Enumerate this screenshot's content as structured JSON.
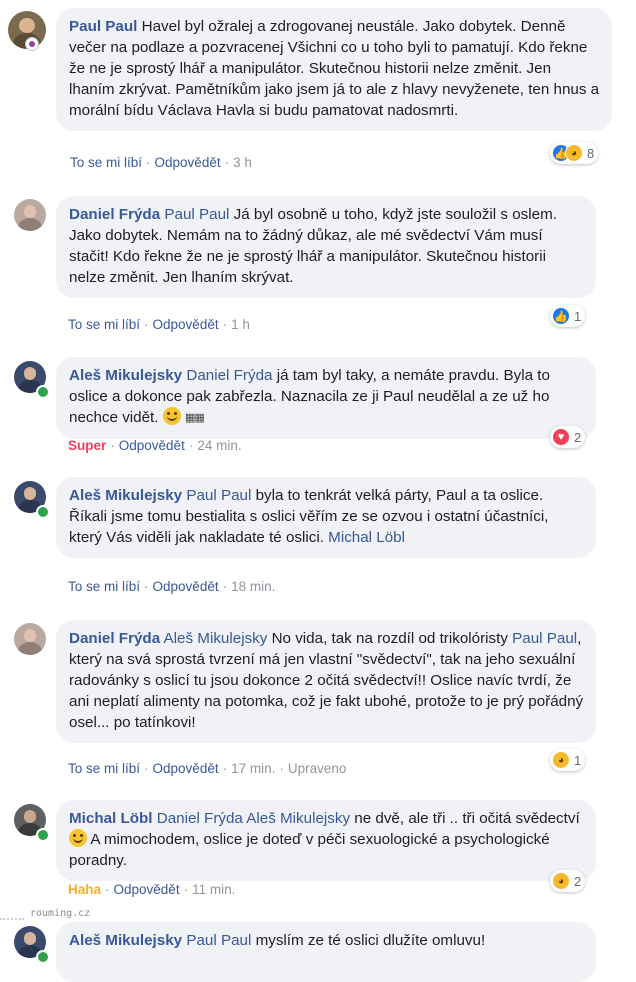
{
  "colors": {
    "link": "#385898",
    "bubble": "#f0f2f5",
    "meta": "#90949c",
    "super": "#f33e58",
    "haha": "#f7b125",
    "online": "#31a24c"
  },
  "comments": [
    {
      "author": "Paul Paul",
      "mentions": "",
      "text": "Havel byl ožralej a zdrogovanej neustále. Jako dobytek. Denně večer na podlaze a pozvracenej Všichni co u toho byli to pamatují. Kdo řekne že ne je sprostý lhář a manipulátor. Skutečnou historii nelze změnit. Jen lhaním zkrývat. Pamětníkům jako jsem já to ale z hlavy nevyženete, ten hnus a morální bídu Václava Havla si budu pamatovat nadosmrti.",
      "like": "To se mi líbí",
      "reply": "Odpovědět",
      "time": "3 h",
      "reaction_icons": [
        "like-icon",
        "haha-icon"
      ],
      "reaction_count": "8"
    },
    {
      "author": "Daniel Frýda",
      "mentions": "Paul Paul",
      "text": " Já byl osobně u toho, když jste souložil s oslem. Jako dobytek. Nemám na to žádný důkaz, ale mé svědectví Vám musí stačit! Kdo řekne že ne je sprostý lhář a manipulátor. Skutečnou historii nelze změnit. Jen lhaním skrývat.",
      "like": "To se mi líbí",
      "reply": "Odpovědět",
      "time": "1 h",
      "reaction_icons": [
        "like-icon"
      ],
      "reaction_count": "1"
    },
    {
      "author": "Aleš Mikulejsky",
      "mentions": "Daniel Frýda",
      "text": " já tam byl taky, a nemáte pravdu. Byla to oslice a dokonce pak zabřezla. Naznacila ze ji Paul neudělal a ze už ho nechce vidět.",
      "emoji": [
        "smirk-emoji-icon",
        "small-flag-icon"
      ],
      "like": "Super",
      "reply": "Odpovědět",
      "time": "24 min.",
      "reaction_icons": [
        "love-icon"
      ],
      "reaction_count": "2"
    },
    {
      "author": "Aleš Mikulejsky",
      "mentions": "Paul Paul",
      "text": " byla to tenkrát velká párty, Paul a ta oslice. Říkali jsme tomu bestialita s oslici věřím ze se ozvou i ostatní účastníci, který Vás viděli jak nakladate té oslici.",
      "trailing_mention": "Michal Löbl",
      "like": "To se mi líbí",
      "reply": "Odpovědět",
      "time": "18 min."
    },
    {
      "author": "Daniel Frýda",
      "mentions": "Aleš Mikulejsky",
      "text_a": " No vida, tak na rozdíl od trikolóristy ",
      "mention_b": "Paul Paul",
      "text_b": ", který na svá sprostá tvrzení má jen vlastní \"svědectví\", tak na jeho sexuální radovánky s oslicí tu jsou dokonce 2 očitá svědectví!! Oslice navíc tvrdí, že ani neplatí alimenty na potomka, což je fakt ubohé, protože to je prý pořádný osel... po tatínkovi!",
      "like": "To se mi líbí",
      "reply": "Odpovědět",
      "time": "17 min.",
      "edited": "Upraveno",
      "reaction_icons": [
        "haha-icon"
      ],
      "reaction_count": "1"
    },
    {
      "author": "Michal Löbl",
      "mentions": "Daniel Frýda Aleš Mikulejsky",
      "text_a": " ne dvě, ale tři .. tři očitá svědectví ",
      "text_b": " A mimochodem, oslice je doteď v péči sexuologické a psychologické poradny.",
      "emoji": [
        "smile-emoji-icon"
      ],
      "like": "Haha",
      "reply": "Odpovědět",
      "time": "11 min.",
      "reaction_icons": [
        "haha-icon"
      ],
      "reaction_count": "2"
    },
    {
      "author": "Aleš Mikulejsky",
      "mentions": "Paul Paul",
      "text": " myslím ze té oslici dlužíte omluvu!"
    }
  ],
  "watermark": "rouming.cz"
}
